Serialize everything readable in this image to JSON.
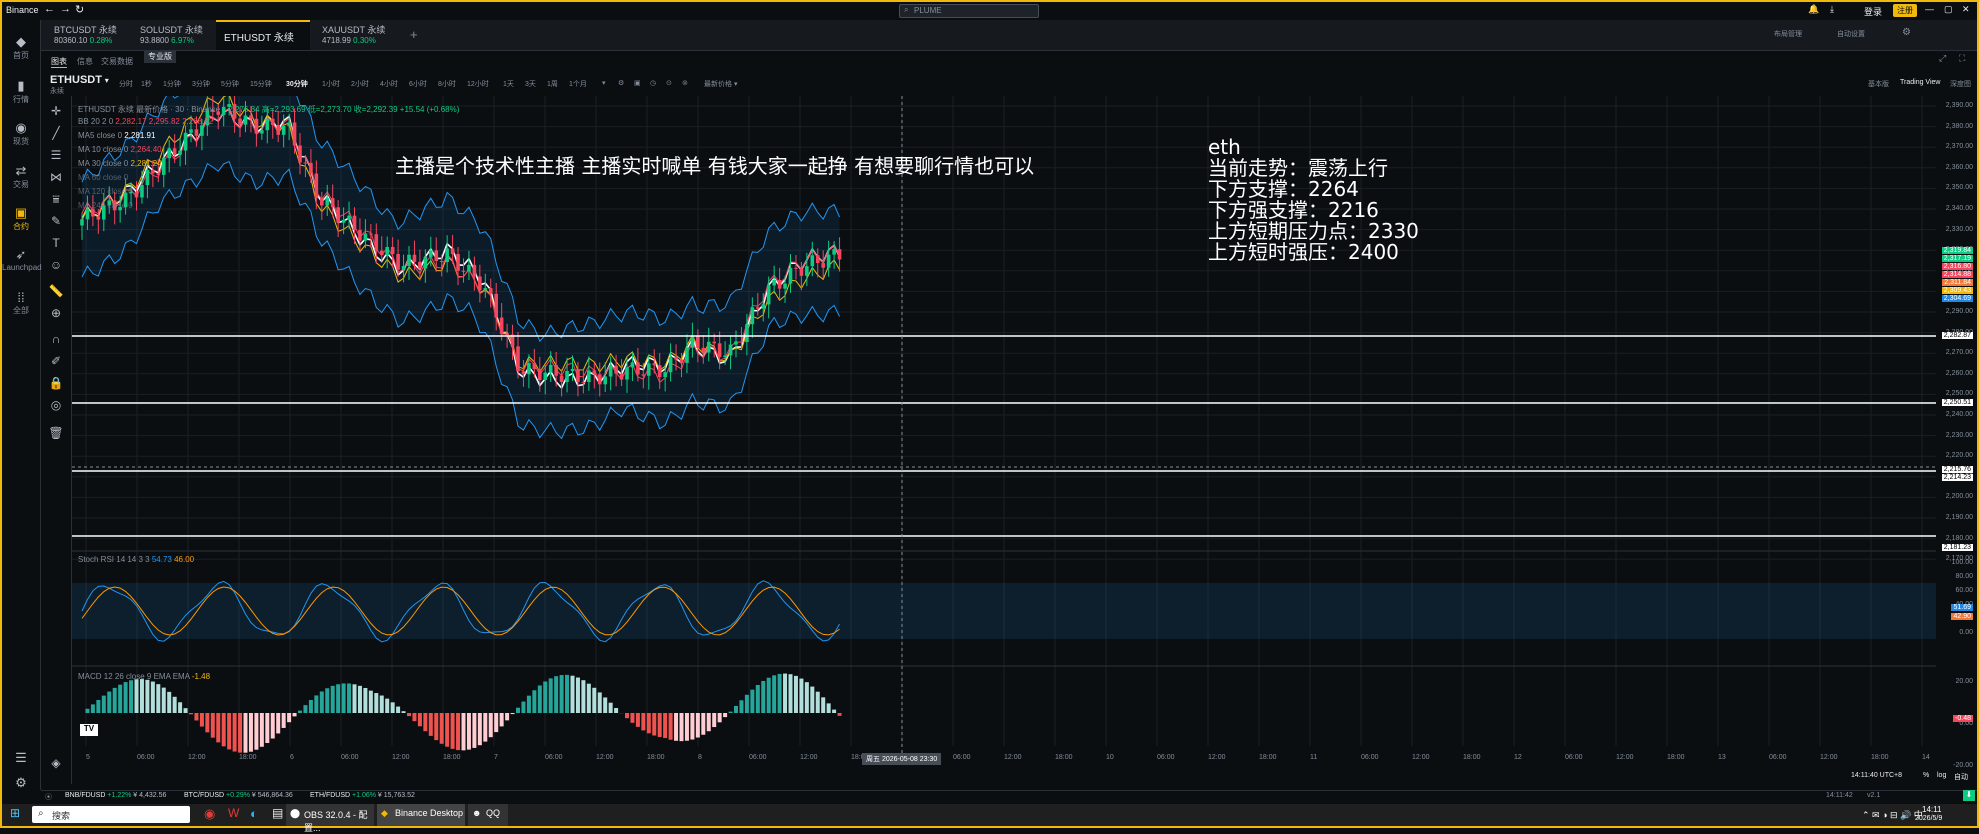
{
  "app": {
    "title": "Binance"
  },
  "search": {
    "placeholder": "PLUME"
  },
  "header": {
    "login": "登录",
    "register": "注册",
    "layout": "布局管理",
    "custom": "自动设置"
  },
  "tabs": [
    {
      "name": "BTCUSDT 永续",
      "price": "80360.10",
      "change": "0.28%"
    },
    {
      "name": "SOLUSDT 永续",
      "price": "93.8800",
      "change": "6.97%"
    },
    {
      "name": "ETHUSDT 永续",
      "price": "",
      "change": ""
    },
    {
      "name": "XAUUSDT 永续",
      "price": "4718.99",
      "change": "0.30%"
    }
  ],
  "nav": [
    {
      "label": "首页",
      "icon": "home-icon"
    },
    {
      "label": "行情",
      "icon": "chart-icon"
    },
    {
      "label": "现货",
      "icon": "spot-icon"
    },
    {
      "label": "交易",
      "icon": "trade-icon"
    },
    {
      "label": "合约",
      "icon": "futures-icon"
    },
    {
      "label": "Launchpad",
      "icon": "rocket-icon"
    },
    {
      "label": "全部",
      "icon": "grid-icon"
    }
  ],
  "subtabs": {
    "chart": "图表",
    "info": "信息",
    "trading_data": "交易数据",
    "pro": "专业版"
  },
  "symbol": {
    "name": "ETHUSDT",
    "sub": "永续"
  },
  "timeframes": [
    "分时",
    "1秒",
    "1分钟",
    "3分钟",
    "5分钟",
    "15分钟",
    "30分钟",
    "1小时",
    "2小时",
    "4小时",
    "6小时",
    "8小时",
    "12小时",
    "1天",
    "3天",
    "1周",
    "1个月"
  ],
  "active_tf": "30分钟",
  "latest_price_label": "最新价格",
  "views": {
    "basic": "基本版",
    "tv": "Trading View",
    "depth": "深度图"
  },
  "legends": {
    "main": "ETHUSDT 永续 最新价格 · 30 · Binance",
    "main_vals": "2,276.84  高=2,293.69  低=2,273.70  收=2,292.39  +15.54 (+0.68%)",
    "bb": "BB 20 2 0",
    "bb_vals": "2,282.17  2,295.82  2,268.52",
    "ma5": "MA5 close 0",
    "ma5_val": "2,281.91",
    "ma10": "MA 10 close 0",
    "ma10_val": "2,264.40",
    "ma30": "MA 30 close 0",
    "ma30_val": "2,281.24",
    "ma60": "MA 60 close 0",
    "ma120": "MA 120 close 0",
    "ma240": "MA 240 close 0",
    "stoch": "Stoch RSI 14 14 3 3",
    "stoch_k": "54.73",
    "stoch_d": "46.00",
    "macd": "MACD 12 26 close 9 EMA EMA",
    "macd_val": "-1.48"
  },
  "overlay": {
    "banner": "主播是个技术性主播 主播实时喊单 有钱大家一起挣 有想要聊行情也可以",
    "lines": [
      "eth",
      "当前走势：震荡上行",
      "下方支撑：2264",
      "下方强支撑：2216",
      "上方短期压力点：2330",
      "上方短时强压：2400"
    ]
  },
  "price_axis": [
    "2,390.00",
    "2,380.00",
    "2,370.00",
    "2,360.00",
    "2,350.00",
    "2,340.00",
    "2,330.00",
    "2,320.00",
    "2,310.00",
    "2,300.00",
    "2,290.00",
    "2,280.00",
    "2,270.00",
    "2,260.00",
    "2,250.00",
    "2,240.00",
    "2,230.00",
    "2,220.00",
    "2,210.00",
    "2,200.00",
    "2,190.00",
    "2,180.00",
    "2,170.00"
  ],
  "price_tags": [
    {
      "text": "2,319.84",
      "color": "#0ecb81"
    },
    {
      "text": "2,317.19",
      "color": "#0ecb81"
    },
    {
      "text": "2,316.80",
      "color": "#f6465d"
    },
    {
      "text": "2,314.88",
      "color": "#f6465d"
    },
    {
      "text": "2,311.84",
      "color": "#f0793a"
    },
    {
      "text": "2,309.43",
      "color": "#f0b90b"
    },
    {
      "text": "2,304.69",
      "color": "#1e88e5"
    }
  ],
  "hlines": [
    "2,282.87",
    "2,250.51",
    "2,214.23",
    "2,181.23"
  ],
  "hline_extra": "2,215.76",
  "stoch_axis": [
    "100.00",
    "80.00",
    "60.00",
    "40.00",
    "20.00",
    "0.00"
  ],
  "stoch_tags": [
    "51.69",
    "42.90"
  ],
  "macd_axis": [
    "20.00",
    "0.00",
    "-20.00"
  ],
  "macd_tag": "-0.48",
  "time_axis": [
    "5",
    "06:00",
    "12:00",
    "18:00",
    "6",
    "06:00",
    "12:00",
    "18:00",
    "7",
    "06:00",
    "12:00",
    "18:00",
    "8",
    "06:00",
    "12:00",
    "18:00",
    "9",
    "06:00",
    "12:00",
    "18:00",
    "10",
    "06:00",
    "12:00",
    "18:00",
    "11",
    "06:00",
    "12:00",
    "18:00",
    "12",
    "06:00",
    "12:00",
    "18:00",
    "13",
    "06:00",
    "12:00",
    "18:00",
    "14"
  ],
  "cursor_time": "周五 2026-05-08  23:30",
  "clock": "14:11:40 UTC+8",
  "scale_opts": [
    "%",
    "log",
    "自动"
  ],
  "ticker": [
    {
      "pair": "BNB/FDUSD",
      "chg": "+1.22%",
      "vol": "¥ 4,432.56"
    },
    {
      "pair": "BTC/FDUSD",
      "chg": "+0.29%",
      "vol": "¥ 546,864.36"
    },
    {
      "pair": "ETH/FDUSD",
      "chg": "+1.06%",
      "vol": "¥ 15,763.52"
    }
  ],
  "bottom_right": {
    "time": "14:11:42",
    "ver": "v2.1"
  },
  "taskbar": {
    "search": "搜索",
    "apps": [
      "OBS 32.0.4 - 配置...",
      "Binance Desktop",
      "QQ"
    ],
    "time": "14:11",
    "date": "2026/5/9"
  }
}
